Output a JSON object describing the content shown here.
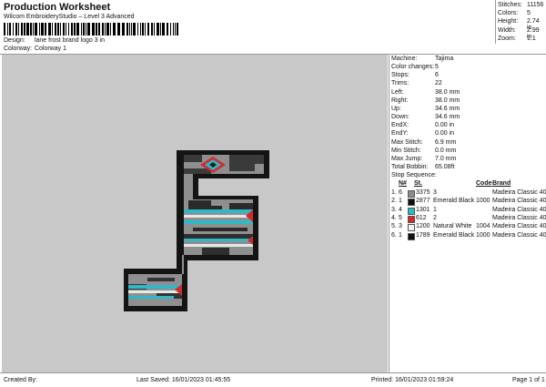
{
  "header": {
    "title": "Production Worksheet",
    "subtitle": "Wilcom EmbroideryStudio – Level 3 Advanced",
    "design_label": "Design:",
    "design_value": "lane frost brand logo 3 in",
    "colorway_label": "Colorway:",
    "colorway_value": "Colorway 1"
  },
  "stats": [
    {
      "label": "Stitches:",
      "value": "11156"
    },
    {
      "label": "Colors:",
      "value": "5"
    },
    {
      "label": "Height:",
      "value": "2.74 in"
    },
    {
      "label": "Width:",
      "value": "2.99 in"
    },
    {
      "label": "Zoom:",
      "value": "1:1"
    }
  ],
  "info": [
    {
      "label": "Machine:",
      "value": "Tajima"
    },
    {
      "label": "Color changes:",
      "value": "5"
    },
    {
      "label": "Stops:",
      "value": "6"
    },
    {
      "label": "Trims:",
      "value": "22"
    },
    {
      "label": "Left:",
      "value": "38.0 mm"
    },
    {
      "label": "Right:",
      "value": "38.0 mm"
    },
    {
      "label": "Up:",
      "value": "34.6 mm"
    },
    {
      "label": "Down:",
      "value": "34.6 mm"
    },
    {
      "label": "EndX:",
      "value": "0.00 in"
    },
    {
      "label": "EndY:",
      "value": "0.00 in"
    },
    {
      "label": "Max Stitch:",
      "value": "6.9 mm"
    },
    {
      "label": "Min Stitch:",
      "value": "0.0 mm"
    },
    {
      "label": "Max Jump:",
      "value": "7.0 mm"
    },
    {
      "label": "Total Bobbin:",
      "value": "65.08ft"
    }
  ],
  "stop_sequence": {
    "title": "Stop Sequence:",
    "headers": [
      "N#",
      "St.",
      "Code",
      "Brand"
    ],
    "rows": [
      {
        "idx": "1.",
        "n": "6",
        "st": "3375",
        "name": "3",
        "code": "",
        "brand": "Madeira Classic 40",
        "color": "#8c8c8c"
      },
      {
        "idx": "2.",
        "n": "1",
        "st": "2877",
        "name": "Emerald Black",
        "code": "1000",
        "brand": "Madeira Classic 40",
        "color": "#111111"
      },
      {
        "idx": "3.",
        "n": "4",
        "st": "1301",
        "name": "1",
        "code": "",
        "brand": "Madeira Classic 40",
        "color": "#2fb8c8"
      },
      {
        "idx": "4.",
        "n": "5",
        "st": "612",
        "name": "2",
        "code": "",
        "brand": "Madeira Classic 40",
        "color": "#d42a2a"
      },
      {
        "idx": "5.",
        "n": "3",
        "st": "1200",
        "name": "Natural White",
        "code": "1004",
        "brand": "Madeira Classic 40",
        "color": "#f2f2f2"
      },
      {
        "idx": "6.",
        "n": "1",
        "st": "1789",
        "name": "Emerald Black",
        "code": "1000",
        "brand": "Madeira Classic 40",
        "color": "#111111"
      }
    ]
  },
  "footer": {
    "created_by": "Created By:",
    "last_saved": "Last Saved: 16/01/2023 01:45:55",
    "printed": "Printed: 16/01/2023 01:59:24",
    "page": "Page 1 of 1"
  }
}
